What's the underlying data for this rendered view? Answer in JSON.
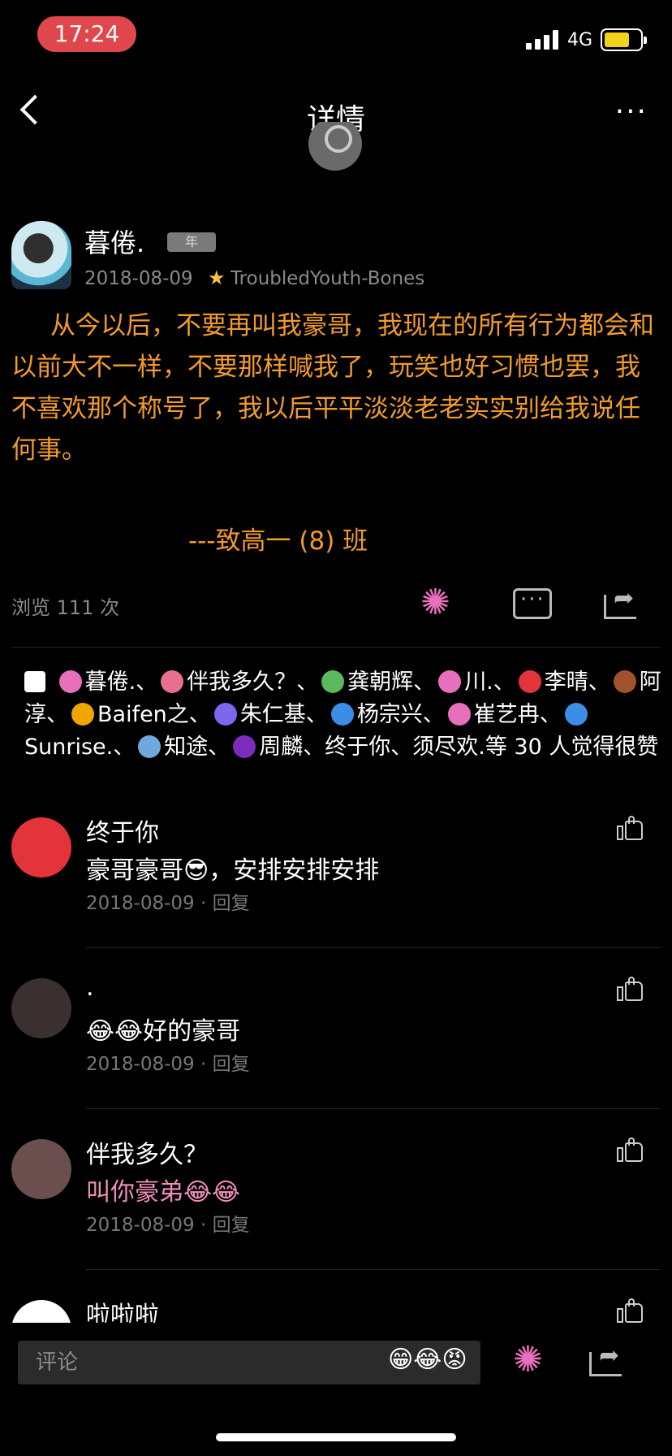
{
  "status_bar": {
    "time": "17:24",
    "network": "4G"
  },
  "nav": {
    "title": "详情",
    "more": "···"
  },
  "post": {
    "author": "暮倦.",
    "badge": "年",
    "date": "2018-08-09",
    "tag": "TroubledYouth-Bones",
    "body": "从今以后，不要再叫我豪哥，我现在的所有行为都会和以前大不一样，不要那样喊我了，玩笑也好习惯也罢，我不喜欢那个称号了，我以后平平淡淡老老实实别给我说任何事。",
    "signature": "---致高一 (8) 班",
    "views": "浏览 111 次"
  },
  "likes": {
    "names": [
      "暮倦.、",
      "伴我多久？、",
      "龚朝辉、",
      "川.、",
      "李晴、",
      "阿淳、",
      "Baifen之、",
      "朱仁基、",
      "杨宗兴、",
      "崔艺冉、",
      "Sunrise.、",
      "知途、",
      "周麟、",
      "终于你、",
      "须尽欢."
    ],
    "suffix": "等 30 人觉得很赞",
    "avatar_colors": [
      "#e86fbb",
      "#e86f8f",
      "#5cb85c",
      "#e86fbb",
      "#e2343a",
      "#a0522d",
      "#f0a500",
      "#7b68ee",
      "#3a8ee6",
      "#e86fbb",
      "#3a8ee6",
      "#6fa8dc",
      "#7b2cbf"
    ]
  },
  "comments": [
    {
      "name": "终于你",
      "text": "豪哥豪哥😎，安排安排安排",
      "date": "2018-08-09",
      "reply": "回复",
      "avatar_color": "#e2343a"
    },
    {
      "name": ".",
      "text": "😂😂好的豪哥",
      "date": "2018-08-09",
      "reply": "回复",
      "avatar_color": "#3a3030"
    },
    {
      "name": "伴我多久？",
      "text": "叫你豪弟😂😂",
      "date": "2018-08-09",
      "reply": "回复",
      "avatar_color": "#6b4e4e"
    },
    {
      "name": "啦啦啦",
      "text": "",
      "date": "",
      "reply": "",
      "avatar_color": "#ffffff"
    }
  ],
  "bottom_bar": {
    "comment_placeholder": "评论",
    "emojis": "😁😂😡"
  }
}
